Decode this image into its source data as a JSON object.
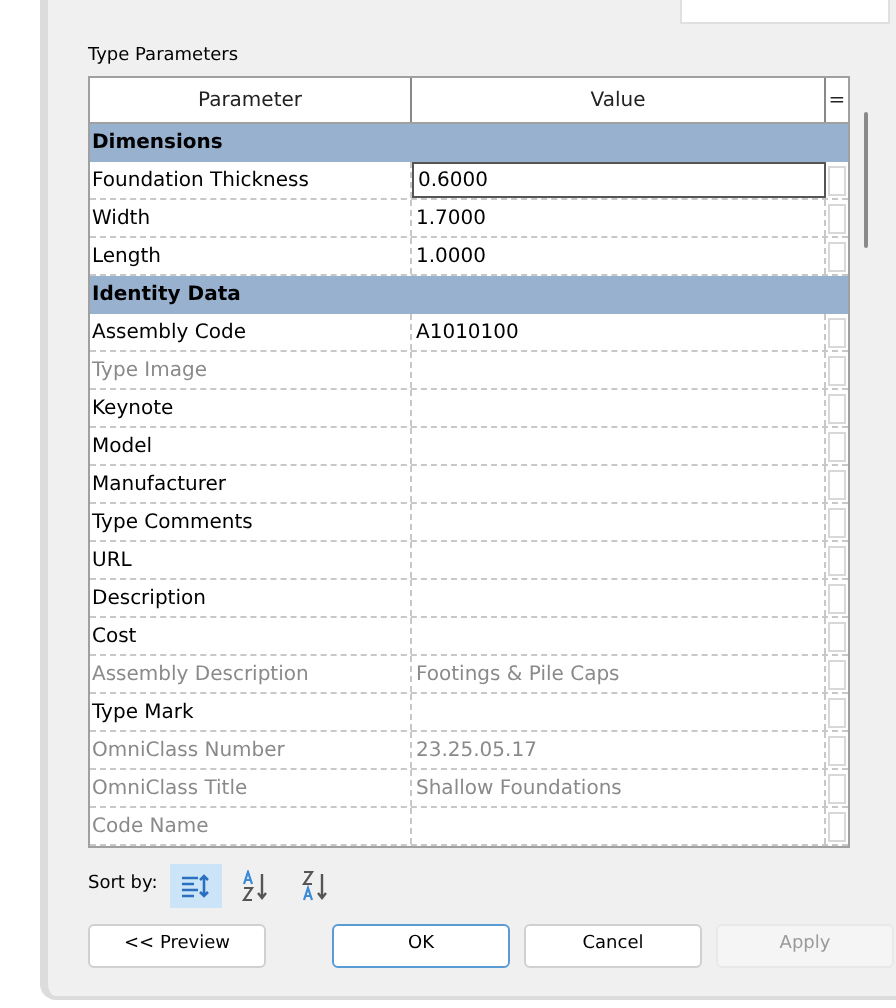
{
  "section_title": "Type Parameters",
  "table": {
    "columns": [
      "Parameter",
      "Value",
      "="
    ],
    "rows": [
      {
        "kind": "group",
        "label": "Dimensions"
      },
      {
        "kind": "param",
        "label": "Foundation Thickness",
        "value": "0.6000",
        "disabled": false,
        "editing": true
      },
      {
        "kind": "param",
        "label": "Width",
        "value": "1.7000",
        "disabled": false,
        "editing": false
      },
      {
        "kind": "param",
        "label": "Length",
        "value": "1.0000",
        "disabled": false,
        "editing": false
      },
      {
        "kind": "group",
        "label": "Identity Data"
      },
      {
        "kind": "param",
        "label": "Assembly Code",
        "value": "A1010100",
        "disabled": false,
        "editing": false
      },
      {
        "kind": "param",
        "label": "Type Image",
        "disabled": true,
        "editing": false
      },
      {
        "kind": "param",
        "label": "Keynote",
        "disabled": false,
        "editing": false
      },
      {
        "kind": "param",
        "label": "Model",
        "disabled": false,
        "editing": false
      },
      {
        "kind": "param",
        "label": "Manufacturer",
        "disabled": false,
        "editing": false
      },
      {
        "kind": "param",
        "label": "Type Comments",
        "disabled": false,
        "editing": false
      },
      {
        "kind": "param",
        "label": "URL",
        "disabled": false,
        "editing": false
      },
      {
        "kind": "param",
        "label": "Description",
        "disabled": false,
        "editing": false
      },
      {
        "kind": "param",
        "label": "Cost",
        "disabled": false,
        "editing": false
      },
      {
        "kind": "param",
        "label": "Assembly Description",
        "value": "Footings & Pile Caps",
        "disabled": true,
        "editing": false
      },
      {
        "kind": "param",
        "label": "Type Mark",
        "disabled": false,
        "editing": false
      },
      {
        "kind": "param",
        "label": "OmniClass Number",
        "value": "23.25.05.17",
        "disabled": true,
        "editing": false
      },
      {
        "kind": "param",
        "label": "OmniClass Title",
        "value": "Shallow Foundations",
        "disabled": true,
        "editing": false
      },
      {
        "kind": "param",
        "label": "Code Name",
        "disabled": true,
        "editing": false
      }
    ]
  },
  "sort": {
    "label": "Sort by:",
    "options": [
      {
        "kind": "grouped",
        "selected": true
      },
      {
        "kind": "ascending",
        "selected": false
      },
      {
        "kind": "descending",
        "selected": false
      }
    ]
  },
  "buttons": [
    {
      "label": "<< Preview",
      "disabled": false,
      "default": false
    },
    {
      "label": "OK",
      "disabled": false,
      "default": true
    },
    {
      "label": "Cancel",
      "disabled": false,
      "default": false
    },
    {
      "label": "Apply",
      "disabled": true,
      "default": false
    }
  ]
}
